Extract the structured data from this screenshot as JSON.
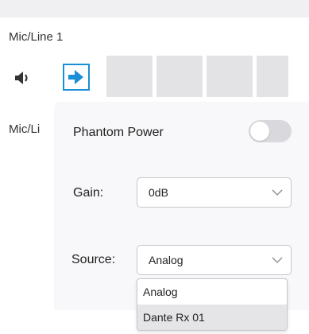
{
  "channels": [
    {
      "label": "Mic/Line 1"
    },
    {
      "label": "Mic/Li"
    }
  ],
  "icons": {
    "speaker": "speaker-icon",
    "route": "route-input-icon",
    "chevron": "chevron-down-icon"
  },
  "colors": {
    "accent": "#1a8fd6",
    "toggle_off": "#d9d9dd"
  },
  "popup": {
    "phantom_power": {
      "label": "Phantom Power",
      "enabled": false
    },
    "gain": {
      "label": "Gain:",
      "value": "0dB"
    },
    "source": {
      "label": "Source:",
      "value": "Analog",
      "options": [
        "Analog",
        "Dante Rx 01"
      ],
      "highlighted": "Dante Rx 01"
    }
  }
}
